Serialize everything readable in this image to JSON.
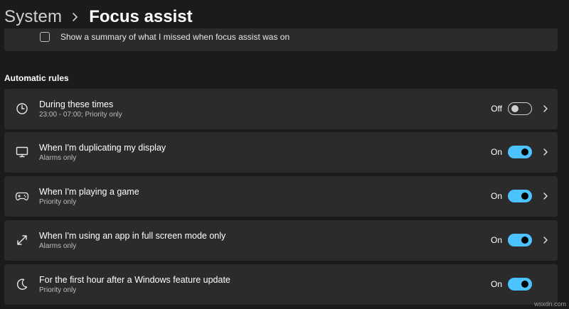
{
  "header": {
    "parent": "System",
    "current": "Focus assist"
  },
  "summary": {
    "label": "Show a summary of what I missed when focus assist was on",
    "checked": false
  },
  "section": {
    "title": "Automatic rules"
  },
  "rules": [
    {
      "icon": "clock-icon",
      "title": "During these times",
      "subtitle": "23:00 - 07:00; Priority only",
      "state": "Off",
      "enabled": false,
      "has_chevron": true
    },
    {
      "icon": "monitor-icon",
      "title": "When I'm duplicating my display",
      "subtitle": "Alarms only",
      "state": "On",
      "enabled": true,
      "has_chevron": true
    },
    {
      "icon": "gamepad-icon",
      "title": "When I'm playing a game",
      "subtitle": "Priority only",
      "state": "On",
      "enabled": true,
      "has_chevron": true
    },
    {
      "icon": "fullscreen-icon",
      "title": "When I'm using an app in full screen mode only",
      "subtitle": "Alarms only",
      "state": "On",
      "enabled": true,
      "has_chevron": true
    },
    {
      "icon": "moon-icon",
      "title": "For the first hour after a Windows feature update",
      "subtitle": "Priority only",
      "state": "On",
      "enabled": true,
      "has_chevron": false
    }
  ],
  "colors": {
    "background": "#1b1b1b",
    "card": "#2b2b2b",
    "accent": "#4cc2ff"
  },
  "watermark": "wsxdn.com"
}
